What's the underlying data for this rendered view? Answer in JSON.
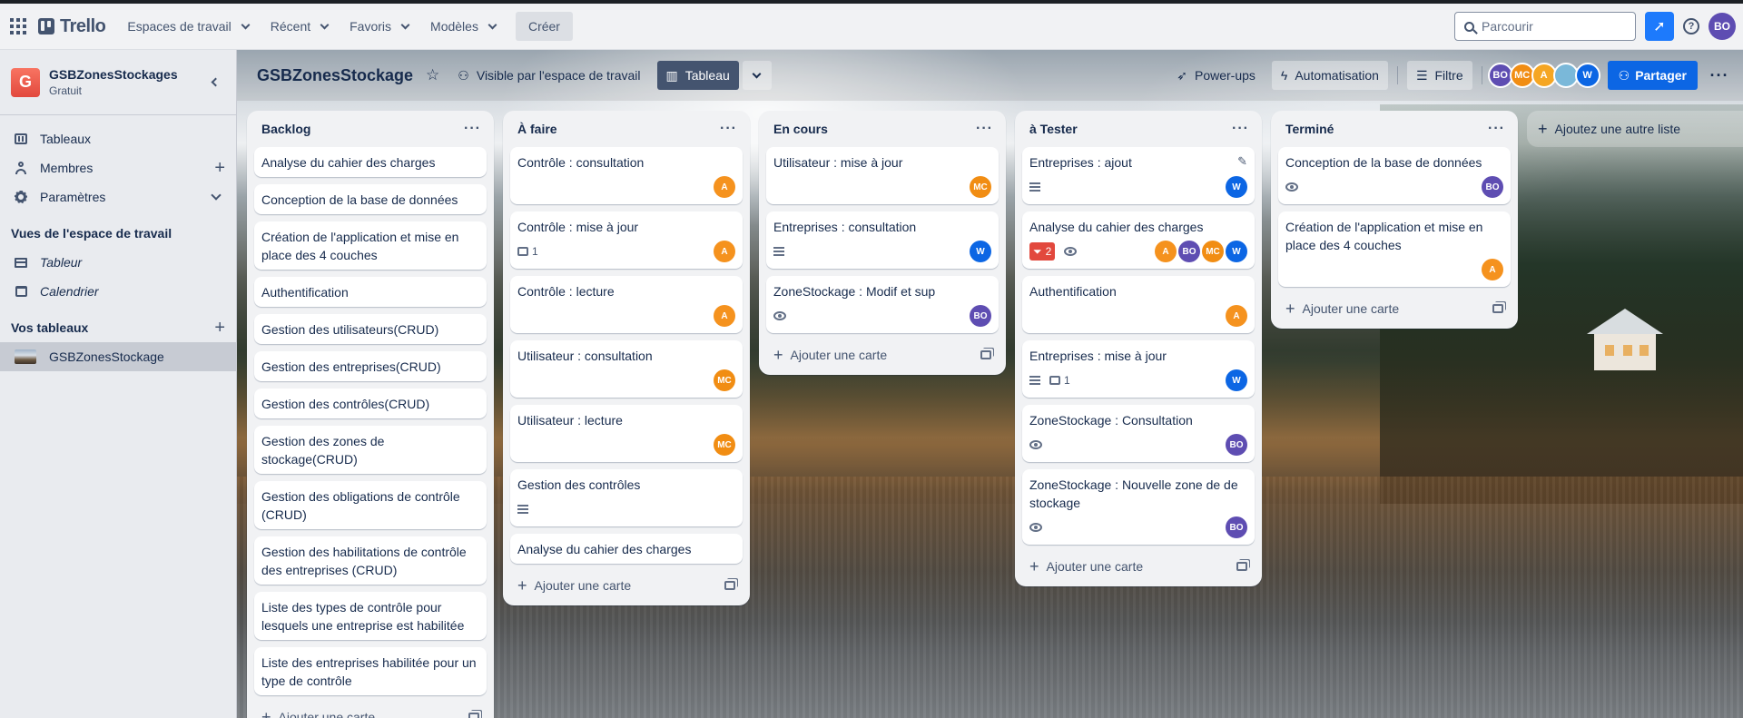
{
  "nav": {
    "logo": "Trello",
    "menus": [
      "Espaces de travail",
      "Récent",
      "Favoris",
      "Modèles"
    ],
    "create": "Créer",
    "search_placeholder": "Parcourir",
    "user_initials": "BO"
  },
  "sidebar": {
    "workspace_initial": "G",
    "workspace_name": "GSBZonesStockages",
    "workspace_plan": "Gratuit",
    "items": [
      {
        "label": "Tableaux"
      },
      {
        "label": "Membres"
      },
      {
        "label": "Paramètres"
      }
    ],
    "views_title": "Vues de l'espace de travail",
    "views": [
      {
        "label": "Tableur"
      },
      {
        "label": "Calendrier"
      }
    ],
    "boards_title": "Vos tableaux",
    "boards": [
      {
        "label": "GSBZonesStockage"
      }
    ]
  },
  "board": {
    "title": "GSBZonesStockage",
    "visibility": "Visible par l'espace de travail",
    "view": "Tableau",
    "powerups": "Power-ups",
    "automation": "Automatisation",
    "filter": "Filtre",
    "share": "Partager",
    "members": [
      {
        "initials": "BO",
        "color": "#5e4db2"
      },
      {
        "initials": "MC",
        "color": "#f18d13"
      },
      {
        "initials": "A",
        "color": "#f5a623"
      },
      {
        "initials": "",
        "color": "#7ab8d9"
      },
      {
        "initials": "W",
        "color": "#0c66e4"
      }
    ],
    "add_card": "Ajouter une carte",
    "add_list": "Ajoutez une autre liste"
  },
  "colors": {
    "A": "#f5921e",
    "MC": "#f18d13",
    "BO": "#5e4db2",
    "W": "#0c66e4",
    "accent": "#0c66e4"
  },
  "lists": [
    {
      "title": "Backlog",
      "cards": [
        {
          "title": "Analyse du cahier des charges"
        },
        {
          "title": "Conception de la base de données"
        },
        {
          "title": "Création de l'application et mise en place des 4 couches"
        },
        {
          "title": "Authentification"
        },
        {
          "title": "Gestion des utilisateurs(CRUD)"
        },
        {
          "title": "Gestion des entreprises(CRUD)"
        },
        {
          "title": "Gestion des contrôles(CRUD)"
        },
        {
          "title": "Gestion des zones de stockage(CRUD)"
        },
        {
          "title": "Gestion des obligations de contrôle (CRUD)"
        },
        {
          "title": "Gestion des habilitations de contrôle des entreprises (CRUD)"
        },
        {
          "title": "Liste des types de contrôle pour lesquels une entreprise est habilitée"
        },
        {
          "title": "Liste des entreprises habilitée pour un type de contrôle"
        }
      ]
    },
    {
      "title": "À faire",
      "cards": [
        {
          "title": "Contrôle : consultation",
          "members": [
            "A"
          ]
        },
        {
          "title": "Contrôle : mise à jour",
          "comments": "1",
          "members": [
            "A"
          ]
        },
        {
          "title": "Contrôle : lecture",
          "members": [
            "A"
          ]
        },
        {
          "title": "Utilisateur : consultation",
          "members": [
            "MC"
          ]
        },
        {
          "title": "Utilisateur : lecture",
          "members": [
            "MC"
          ]
        },
        {
          "title": "Gestion des contrôles",
          "desc": true
        },
        {
          "title": "Analyse du cahier des charges"
        }
      ]
    },
    {
      "title": "En cours",
      "cards": [
        {
          "title": "Utilisateur : mise à jour",
          "members": [
            "MC"
          ]
        },
        {
          "title": "Entreprises : consultation",
          "desc": true,
          "members": [
            "W"
          ]
        },
        {
          "title": "ZoneStockage : Modif et sup",
          "watch": true,
          "members": [
            "BO"
          ]
        }
      ]
    },
    {
      "title": "à Tester",
      "cards": [
        {
          "title": "Entreprises : ajout",
          "desc": true,
          "members": [
            "W"
          ],
          "edit": true
        },
        {
          "title": "Analyse du cahier des charges",
          "red": "2",
          "watch": true,
          "members": [
            "A",
            "BO",
            "MC",
            "W"
          ]
        },
        {
          "title": "Authentification",
          "members": [
            "A"
          ]
        },
        {
          "title": "Entreprises : mise à jour",
          "desc": true,
          "comments": "1",
          "members": [
            "W"
          ]
        },
        {
          "title": "ZoneStockage : Consultation",
          "watch": true,
          "members": [
            "BO"
          ]
        },
        {
          "title": "ZoneStockage : Nouvelle zone de de stockage",
          "watch": true,
          "members": [
            "BO"
          ]
        }
      ]
    },
    {
      "title": "Terminé",
      "cards": [
        {
          "title": "Conception de la base de données",
          "watch": true,
          "members": [
            "BO"
          ]
        },
        {
          "title": "Création de l'application et mise en place des 4 couches",
          "members": [
            "A"
          ]
        }
      ]
    }
  ]
}
